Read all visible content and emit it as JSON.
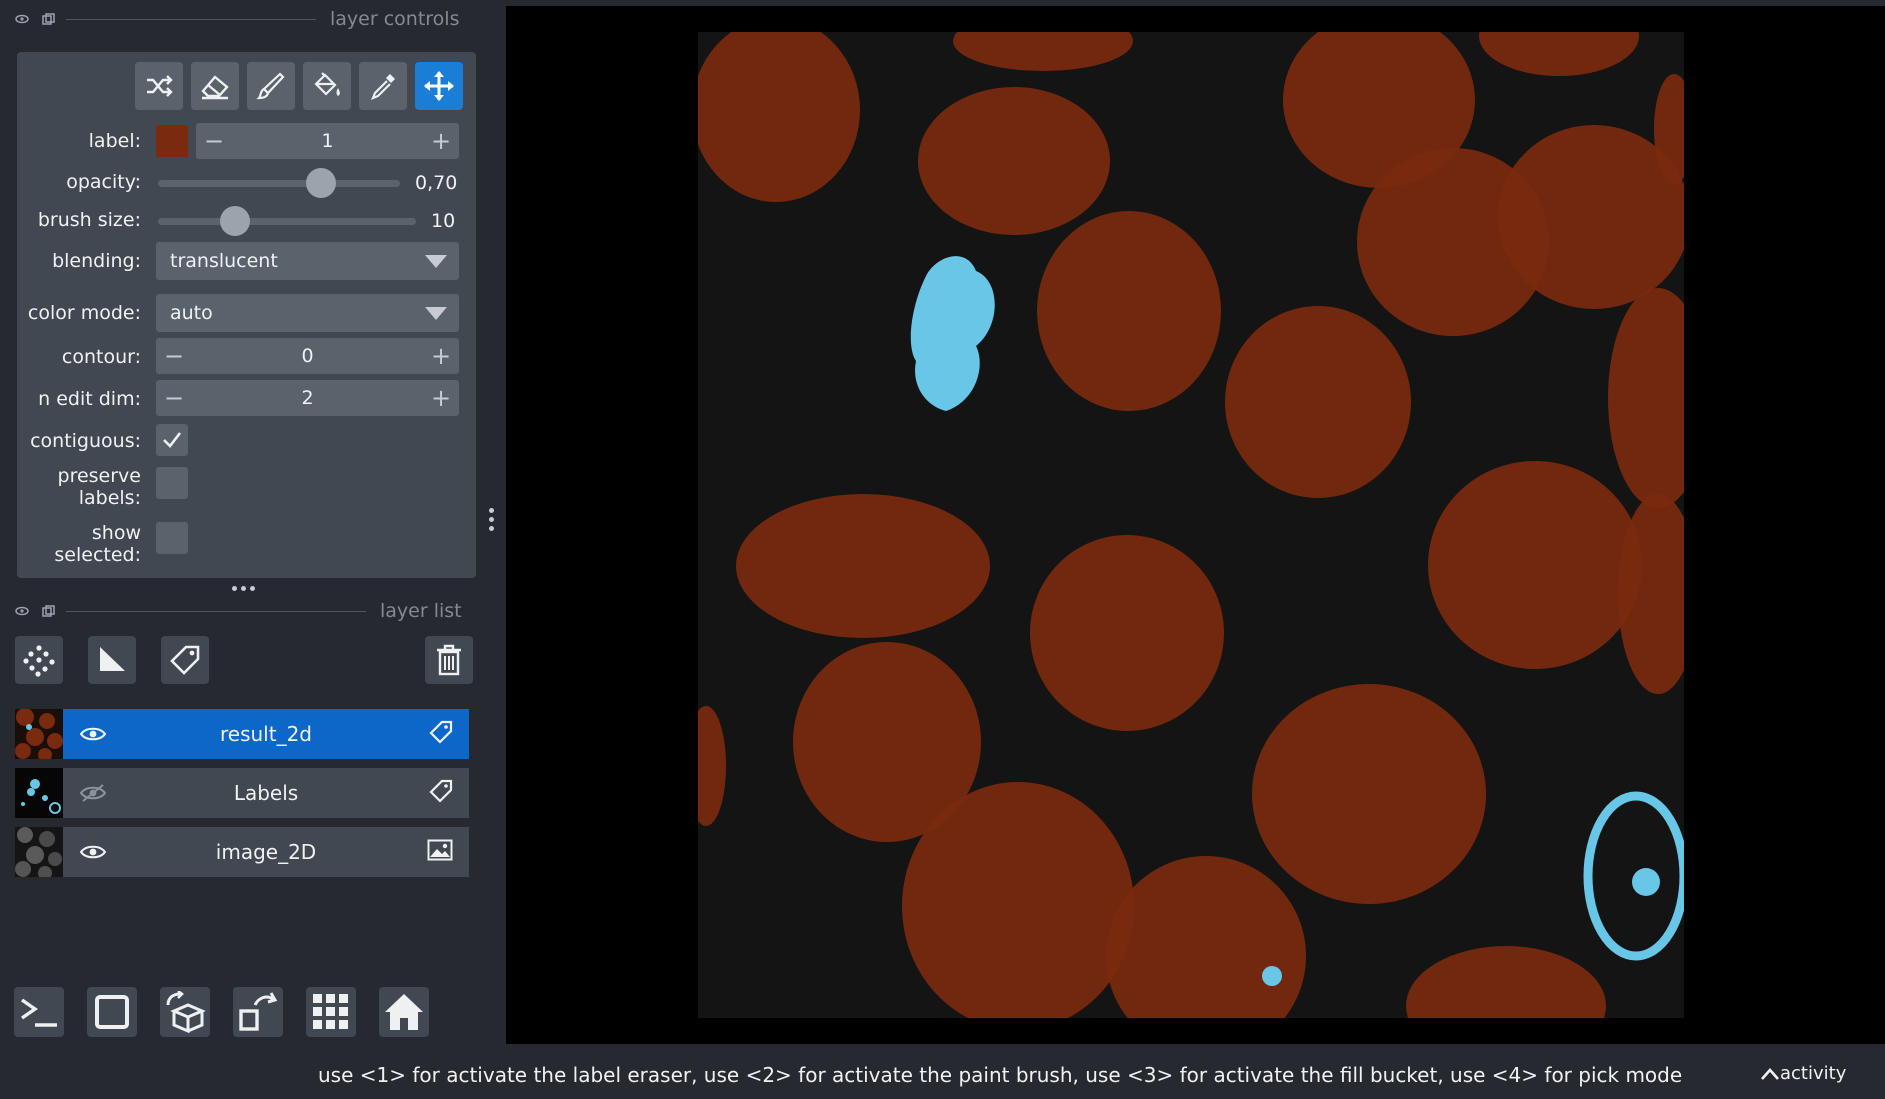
{
  "layer_controls": {
    "title": "layer controls",
    "tools": [
      {
        "icon": "shuffle-icon",
        "active": false
      },
      {
        "icon": "eraser-icon",
        "active": false
      },
      {
        "icon": "paint-brush-icon",
        "active": false
      },
      {
        "icon": "fill-bucket-icon",
        "active": false
      },
      {
        "icon": "color-picker-icon",
        "active": false
      },
      {
        "icon": "pan-zoom-move-icon",
        "active": true
      }
    ],
    "label": {
      "text": "label:",
      "value": "1",
      "color": "#7a2a0e"
    },
    "opacity": {
      "text": "opacity:",
      "value": "0,70",
      "fraction": 0.7
    },
    "brush_size": {
      "text": "brush size:",
      "value": "10",
      "fraction": 0.27
    },
    "blending": {
      "text": "blending:",
      "value": "translucent"
    },
    "color_mode": {
      "text": "color mode:",
      "value": "auto"
    },
    "contour": {
      "text": "contour:",
      "value": "0"
    },
    "n_edit_dim": {
      "text": "n edit dim:",
      "value": "2"
    },
    "contiguous": {
      "text": "contiguous:",
      "checked": true
    },
    "preserve_labels": {
      "line1": "preserve",
      "line2": "labels:",
      "checked": false
    },
    "show_selected": {
      "line1": "show",
      "line2": "selected:",
      "checked": false
    }
  },
  "layer_list": {
    "title": "layer list",
    "buttons": [
      "new-points-layer-icon",
      "new-shapes-layer-icon",
      "new-labels-layer-icon",
      "delete-layer-icon"
    ],
    "layers": [
      {
        "name": "result_2d",
        "visible": true,
        "selected": true,
        "type_icon": "label-tag-icon"
      },
      {
        "name": "Labels",
        "visible": false,
        "selected": false,
        "type_icon": "label-tag-icon"
      },
      {
        "name": "image_2D",
        "visible": true,
        "selected": false,
        "type_icon": "image-icon"
      }
    ]
  },
  "viewer_buttons": [
    "console-icon",
    "toggle-ndisplay-icon",
    "roll-dims-icon",
    "transpose-icon",
    "grid-mode-icon",
    "home-icon"
  ],
  "status": {
    "message": "use <1> for activate the label eraser, use <2> for activate the paint brush, use <3> for activate the fill bucket, use <4> for pick mode",
    "activity": "activity"
  },
  "colors": {
    "accent": "#0d67c8",
    "label_orange": "#7a2a0e",
    "label_cyan": "#68c6e6",
    "panel": "#414851",
    "bg": "#262930"
  }
}
